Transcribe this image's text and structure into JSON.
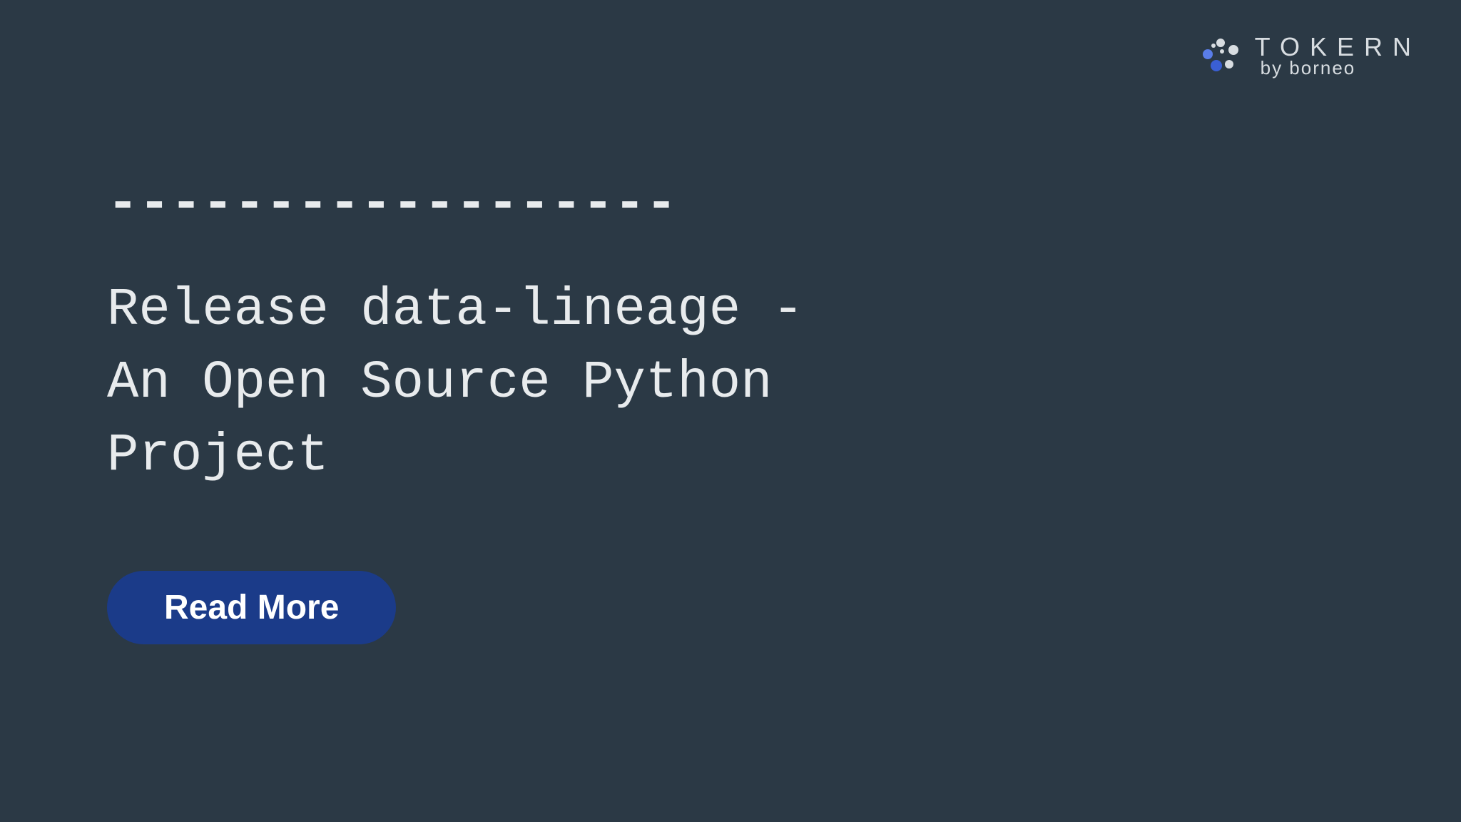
{
  "logo": {
    "title": "TOKERN",
    "subtitle": "by borneo"
  },
  "content": {
    "dashes": "------------------",
    "headline": "Release data-lineage -\nAn Open Source Python\nProject"
  },
  "cta": {
    "label": "Read More"
  },
  "colors": {
    "background": "#2b3945",
    "text": "#e8ebed",
    "button": "#1b3b89",
    "buttonText": "#ffffff"
  }
}
